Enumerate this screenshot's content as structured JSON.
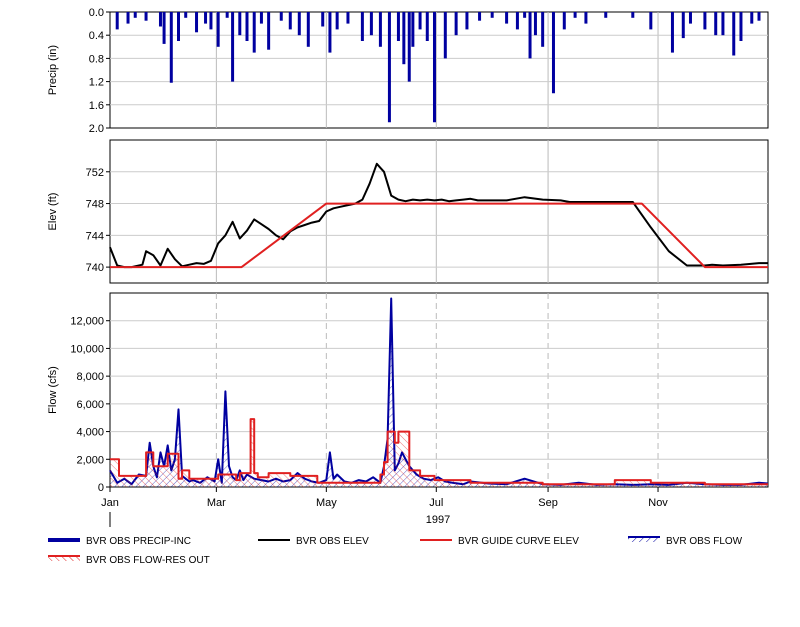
{
  "chart_data": [
    {
      "type": "bar",
      "ylabel": "Precip (in)",
      "ylim": [
        0.0,
        2.0
      ],
      "y_inverted": true,
      "yticks": [
        "0.0",
        "0.4",
        "0.8",
        "1.2",
        "1.6",
        "2.0"
      ],
      "grid": true,
      "series": [
        {
          "name": "BVR OBS PRECIP-INC",
          "color": "#0000a0",
          "x_day": [
            4,
            10,
            14,
            20,
            28,
            30,
            34,
            38,
            42,
            48,
            53,
            56,
            60,
            65,
            68,
            72,
            76,
            80,
            84,
            88,
            95,
            100,
            105,
            110,
            118,
            122,
            126,
            132,
            140,
            145,
            150,
            155,
            160,
            163,
            166,
            168,
            172,
            176,
            180,
            186,
            192,
            198,
            205,
            212,
            220,
            226,
            230,
            233,
            236,
            240,
            246,
            252,
            258,
            264,
            275,
            290,
            300,
            312,
            318,
            322,
            330,
            336,
            340,
            346,
            350,
            356,
            360
          ],
          "values": [
            0.3,
            0.2,
            0.1,
            0.15,
            0.25,
            0.55,
            1.22,
            0.5,
            0.1,
            0.35,
            0.2,
            0.3,
            0.6,
            0.1,
            1.2,
            0.4,
            0.5,
            0.7,
            0.2,
            0.65,
            0.15,
            0.3,
            0.4,
            0.6,
            0.25,
            0.7,
            0.3,
            0.2,
            0.5,
            0.4,
            0.6,
            1.9,
            0.5,
            0.9,
            1.2,
            0.6,
            0.3,
            0.5,
            1.9,
            0.8,
            0.4,
            0.3,
            0.15,
            0.1,
            0.2,
            0.3,
            0.1,
            0.8,
            0.4,
            0.6,
            1.4,
            0.3,
            0.1,
            0.2,
            0.1,
            0.1,
            0.3,
            0.7,
            0.45,
            0.2,
            0.3,
            0.4,
            0.4,
            0.75,
            0.5,
            0.2,
            0.15
          ]
        }
      ]
    },
    {
      "type": "line",
      "ylabel": "Elev (ft)",
      "ylim": [
        738,
        756
      ],
      "yticks": [
        "740",
        "744",
        "748",
        "752"
      ],
      "grid": true,
      "series": [
        {
          "name": "BVR OBS ELEV",
          "color": "#000000",
          "x_day": [
            0,
            4,
            8,
            12,
            18,
            20,
            24,
            28,
            32,
            36,
            40,
            44,
            48,
            52,
            56,
            60,
            64,
            68,
            72,
            76,
            80,
            84,
            88,
            92,
            96,
            100,
            104,
            108,
            112,
            116,
            120,
            124,
            128,
            132,
            136,
            140,
            144,
            148,
            152,
            156,
            160,
            164,
            168,
            172,
            176,
            180,
            184,
            188,
            192,
            196,
            200,
            204,
            208,
            212,
            220,
            230,
            240,
            250,
            255,
            260,
            270,
            280,
            290,
            300,
            310,
            320,
            330,
            334,
            340,
            350,
            360,
            365
          ],
          "values": [
            742.5,
            740.2,
            740.0,
            740.0,
            740.3,
            742.0,
            741.5,
            740.2,
            742.3,
            741.0,
            740.1,
            740.3,
            740.5,
            740.4,
            740.8,
            743.0,
            744.0,
            745.7,
            743.6,
            744.6,
            746.0,
            745.4,
            744.8,
            744.0,
            743.5,
            744.5,
            745.0,
            745.3,
            745.6,
            745.8,
            747.0,
            747.4,
            747.6,
            747.8,
            748.0,
            748.5,
            750.5,
            753.0,
            752.0,
            749.0,
            748.5,
            748.3,
            748.5,
            748.4,
            748.5,
            748.4,
            748.5,
            748.3,
            748.4,
            748.5,
            748.6,
            748.4,
            748.4,
            748.4,
            748.4,
            748.8,
            748.5,
            748.4,
            748.2,
            748.2,
            748.2,
            748.2,
            748.2,
            745.0,
            742.0,
            740.2,
            740.2,
            740.3,
            740.2,
            740.3,
            740.5,
            740.5
          ]
        },
        {
          "name": "BVR GUIDE CURVE ELEV",
          "color": "#e02020",
          "x_day": [
            0,
            73,
            120,
            295,
            330,
            365
          ],
          "values": [
            740,
            740,
            748,
            748,
            740,
            740
          ]
        }
      ]
    },
    {
      "type": "line",
      "ylabel": "Flow (cfs)",
      "ylim": [
        0,
        14000
      ],
      "yticks": [
        "0",
        "2,000",
        "4,000",
        "6,000",
        "8,000",
        "10,000",
        "12,000"
      ],
      "grid": true,
      "series": [
        {
          "name": "BVR OBS FLOW",
          "color": "#0000a0",
          "x_day": [
            0,
            4,
            8,
            12,
            16,
            20,
            22,
            24,
            26,
            28,
            30,
            32,
            34,
            36,
            38,
            40,
            42,
            44,
            46,
            50,
            54,
            58,
            60,
            62,
            64,
            66,
            68,
            70,
            72,
            74,
            76,
            80,
            84,
            88,
            92,
            96,
            100,
            104,
            108,
            112,
            116,
            120,
            122,
            124,
            126,
            130,
            134,
            138,
            142,
            146,
            150,
            152,
            154,
            156,
            158,
            160,
            162,
            164,
            166,
            170,
            174,
            178,
            182,
            186,
            190,
            196,
            200,
            210,
            220,
            230,
            240,
            250,
            260,
            270,
            280,
            290,
            300,
            310,
            320,
            330,
            340,
            350,
            360,
            365
          ],
          "values": [
            1200,
            300,
            600,
            200,
            900,
            800,
            3200,
            1500,
            700,
            2500,
            1500,
            3000,
            1200,
            2000,
            5600,
            800,
            600,
            400,
            500,
            300,
            700,
            400,
            2000,
            300,
            6900,
            1500,
            700,
            500,
            1200,
            500,
            900,
            600,
            500,
            400,
            600,
            400,
            500,
            1000,
            600,
            400,
            300,
            500,
            2500,
            600,
            900,
            400,
            300,
            500,
            400,
            700,
            300,
            1500,
            3500,
            13600,
            1200,
            1700,
            2500,
            2000,
            1500,
            900,
            600,
            500,
            700,
            400,
            300,
            200,
            400,
            250,
            200,
            600,
            200,
            150,
            300,
            150,
            200,
            150,
            200,
            150,
            300,
            200,
            150,
            150,
            300,
            250
          ]
        },
        {
          "name": "BVR OBS FLOW-RES OUT",
          "color": "#e02020",
          "x_day": [
            0,
            5,
            5,
            20,
            20,
            24,
            24,
            32,
            32,
            38,
            38,
            40,
            40,
            44,
            44,
            60,
            60,
            70,
            70,
            72,
            72,
            78,
            78,
            80,
            80,
            82,
            82,
            88,
            88,
            100,
            100,
            115,
            115,
            150,
            150,
            152,
            152,
            154,
            154,
            158,
            158,
            160,
            160,
            166,
            166,
            172,
            172,
            180,
            180,
            200,
            200,
            240,
            240,
            280,
            280,
            300,
            300,
            330,
            330,
            365
          ],
          "values": [
            2000,
            2000,
            800,
            800,
            2500,
            2500,
            1500,
            1500,
            2400,
            2400,
            600,
            600,
            1200,
            1200,
            600,
            600,
            900,
            900,
            500,
            500,
            1000,
            1000,
            4900,
            4900,
            1000,
            1000,
            700,
            700,
            1000,
            1000,
            800,
            800,
            300,
            300,
            900,
            900,
            1800,
            1800,
            4000,
            4000,
            3200,
            3200,
            4000,
            4000,
            1200,
            1200,
            800,
            800,
            500,
            500,
            300,
            300,
            200,
            200,
            500,
            500,
            300,
            300,
            200,
            200
          ]
        }
      ]
    }
  ],
  "x_axis": {
    "year_label": "1997",
    "months": [
      {
        "label": "Jan",
        "day": 0
      },
      {
        "label": "Mar",
        "day": 59
      },
      {
        "label": "May",
        "day": 120
      },
      {
        "label": "Jul",
        "day": 181
      },
      {
        "label": "Sep",
        "day": 243
      },
      {
        "label": "Nov",
        "day": 304
      }
    ],
    "days_in_year": 365
  },
  "legend": [
    {
      "label": "BVR OBS PRECIP-INC",
      "color": "#0000a0",
      "style": "thick"
    },
    {
      "label": "BVR OBS ELEV",
      "color": "#000000",
      "style": "line"
    },
    {
      "label": "BVR GUIDE CURVE ELEV",
      "color": "#e02020",
      "style": "line"
    },
    {
      "label": "BVR OBS FLOW",
      "color": "#0000a0",
      "style": "hatch"
    },
    {
      "label": "BVR OBS FLOW-RES OUT",
      "color": "#e02020",
      "style": "hatch"
    }
  ]
}
